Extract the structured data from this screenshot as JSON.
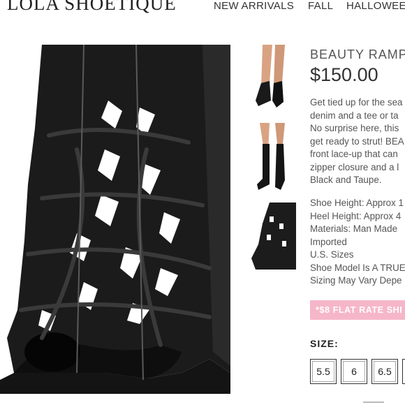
{
  "header": {
    "logo": "LOLA SHOETIQUE",
    "nav": [
      "NEW ARRIVALS",
      "FALL",
      "HALLOWEE"
    ]
  },
  "product": {
    "title": "BEAUTY RAMP",
    "price": "$150.00",
    "description_lines": [
      "Get tied up for the sea",
      "denim and a tee or ta",
      "No surprise here, this",
      "get ready to strut! BEA",
      "front lace-up that can",
      "zipper closure and a l",
      "Black and Taupe."
    ],
    "spec_lines": [
      "Shoe Height: Approx 1",
      "Heel Height: Approx 4",
      "Materials: Man Made",
      "Imported",
      "U.S. Sizes",
      "Shoe Model Is A TRUE",
      "Sizing May Vary Depe"
    ],
    "promo": "*$8 FLAT RATE SHI",
    "size_label": "SIZE:",
    "sizes": [
      "5.5",
      "6",
      "6.5"
    ]
  },
  "images": {
    "main": "black-lace-up-bootie-closeup",
    "thumbnails": [
      "model-lace-up-front",
      "model-lace-up-full",
      "bootie-side-detail"
    ]
  },
  "colors": {
    "promo_bg": "#f6b6c9",
    "text": "#555555",
    "price": "#333333"
  }
}
